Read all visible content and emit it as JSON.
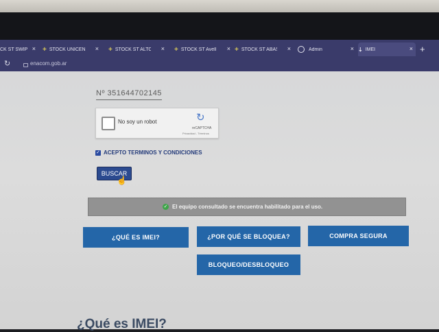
{
  "tabs": [
    {
      "title": "CK ST SWIP",
      "icon": "plus-icon"
    },
    {
      "title": "STOCK UNICEN",
      "icon": "plus-icon"
    },
    {
      "title": "STOCK ST ALTO",
      "icon": "plus-icon"
    },
    {
      "title": "STOCK ST Avell",
      "icon": "plus-icon"
    },
    {
      "title": "STOCK ST ABAS",
      "icon": "plus-icon"
    },
    {
      "title": "Admin",
      "icon": "globe-icon"
    },
    {
      "title": "IMEI",
      "icon": "download-icon"
    }
  ],
  "address_bar": {
    "url": "enacom.gob.ar"
  },
  "form": {
    "imei_value": "Nº 351644702145",
    "captcha_label": "No soy un robot",
    "captcha_brand": "reCAPTCHA",
    "captcha_terms": "Privacidad - Términos",
    "terms_label": "ACEPTO TERMINOS Y CONDICIONES",
    "search_button": "BUSCAR"
  },
  "alert": {
    "text": "El equipo consultado se encuentra habilitado para el uso.",
    "color": "#929292"
  },
  "info_buttons": {
    "what_is": "¿QUÉ ES IMEI?",
    "why_blocked": "¿POR QUÉ SE BLOQUEA?",
    "safe_purchase": "COMPRA SEGURA",
    "lock_unlock": "BLOQUEO/DESBLOQUEO"
  },
  "section_title": "¿Qué es IMEI?",
  "colors": {
    "accent": "#2466a8",
    "tabbar": "#3a3b6a",
    "success": "#3fa54a"
  }
}
